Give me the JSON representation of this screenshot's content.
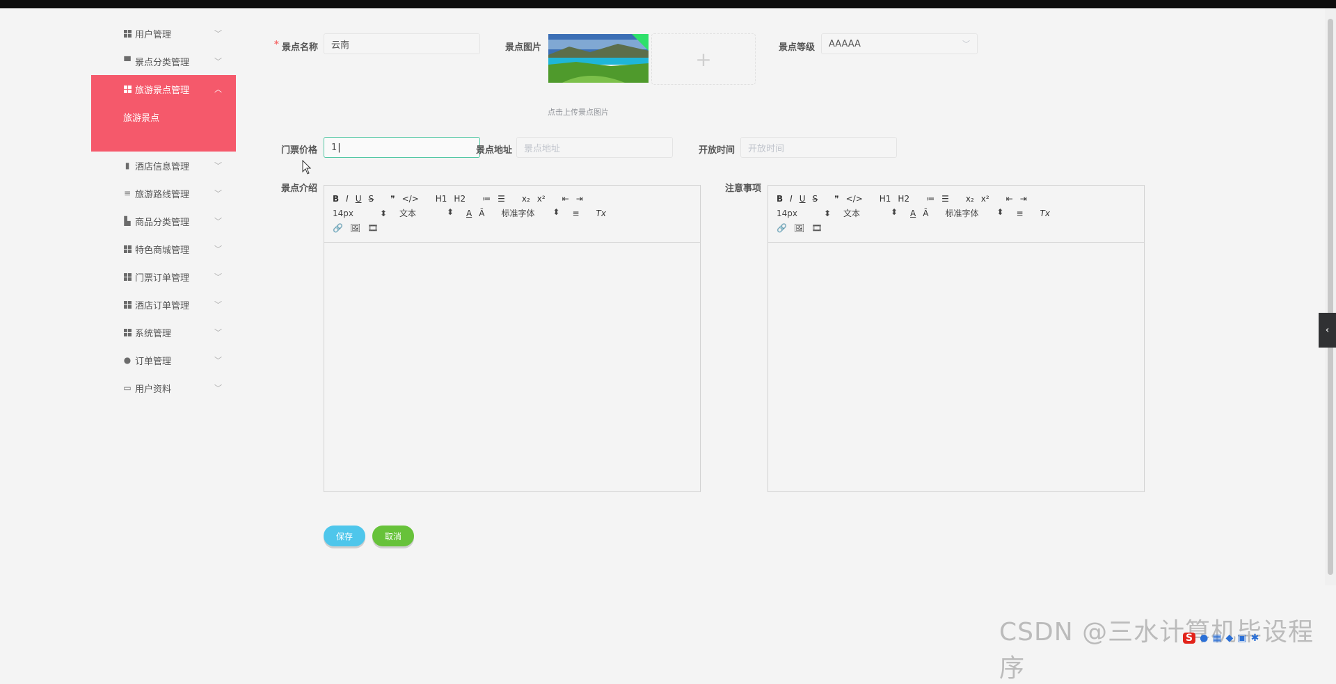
{
  "sidebar": {
    "items": [
      {
        "label": "用户管理"
      },
      {
        "label": "景点分类管理"
      },
      {
        "label": "旅游景点管理",
        "sub": "旅游景点"
      },
      {
        "label": "酒店信息管理"
      },
      {
        "label": "旅游路线管理"
      },
      {
        "label": "商品分类管理"
      },
      {
        "label": "特色商城管理"
      },
      {
        "label": "门票订单管理"
      },
      {
        "label": "酒店订单管理"
      },
      {
        "label": "系统管理"
      },
      {
        "label": "订单管理"
      },
      {
        "label": "用户资料"
      }
    ]
  },
  "form": {
    "required_mark": "*",
    "name_label": "景点名称",
    "name_value": "云南",
    "image_label": "景点图片",
    "upload_hint": "点击上传景点图片",
    "upload_plus": "+",
    "level_label": "景点等级",
    "level_value": "AAAAA",
    "price_label": "门票价格",
    "price_value": "1",
    "address_label": "景点地址",
    "address_placeholder": "景点地址",
    "open_label": "开放时间",
    "open_placeholder": "开放时间",
    "intro_label": "景点介绍",
    "notes_label": "注意事项"
  },
  "editor_toolbar": {
    "row1": [
      "B",
      "I",
      "U",
      "S",
      "❞",
      "</>",
      "H1",
      "H2",
      "≔",
      "☰",
      "x₂",
      "x²",
      "⇤",
      "⇥"
    ],
    "size": "14px",
    "header": "文本",
    "font": "标准字体",
    "row2_icons": [
      "A",
      "Ā",
      "≡",
      "Tx"
    ],
    "row3": [
      "🔗",
      "🖼",
      "🎞"
    ]
  },
  "buttons": {
    "save": "保存",
    "cancel": "取消"
  },
  "watermark": "CSDN @三水计算机毕设程序",
  "colors": {
    "accent": "#f5596b",
    "save": "#4ec6eb",
    "cancel": "#67c23a"
  }
}
